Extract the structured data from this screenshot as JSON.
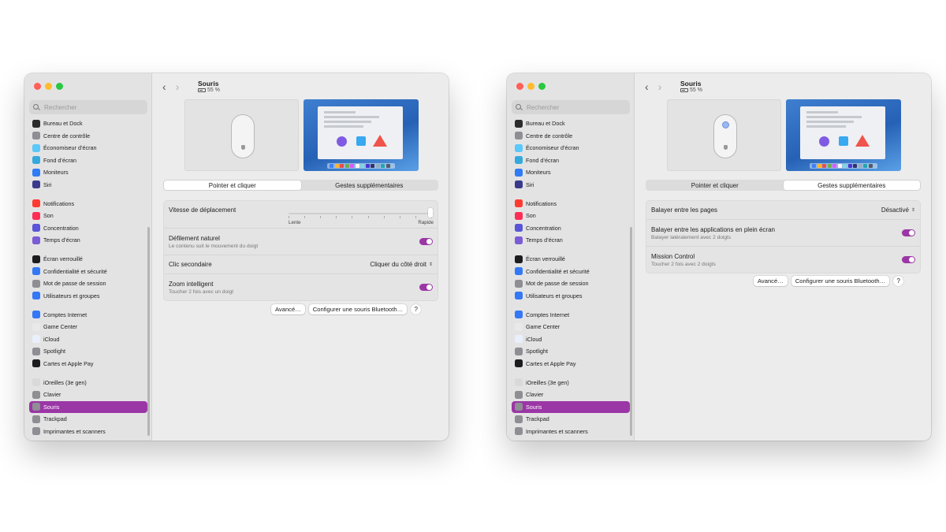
{
  "sidebar": {
    "search_placeholder": "Rechercher",
    "items": [
      {
        "label": "Bureau et Dock",
        "icon": "dock-icon",
        "color": "#2b2b2b"
      },
      {
        "label": "Centre de contrôle",
        "icon": "control-center-icon",
        "color": "#8e8e93"
      },
      {
        "label": "Économiseur d’écran",
        "icon": "screensaver-icon",
        "color": "#5ac8fa"
      },
      {
        "label": "Fond d’écran",
        "icon": "wallpaper-icon",
        "color": "#34aadc"
      },
      {
        "label": "Moniteurs",
        "icon": "displays-icon",
        "color": "#2f7cf6"
      },
      {
        "label": "Siri",
        "icon": "siri-icon",
        "color": "#3a3a8c"
      },
      {
        "label": "Notifications",
        "icon": "notifications-icon",
        "color": "#ff3b30"
      },
      {
        "label": "Son",
        "icon": "sound-icon",
        "color": "#ff2d55"
      },
      {
        "label": "Concentration",
        "icon": "focus-icon",
        "color": "#5856d6"
      },
      {
        "label": "Temps d’écran",
        "icon": "screen-time-icon",
        "color": "#7b5cd6"
      },
      {
        "label": "Écran verrouillé",
        "icon": "lock-screen-icon",
        "color": "#1c1c1e"
      },
      {
        "label": "Confidentialité et sécurité",
        "icon": "privacy-icon",
        "color": "#3478f6"
      },
      {
        "label": "Mot de passe de session",
        "icon": "password-icon",
        "color": "#8e8e93"
      },
      {
        "label": "Utilisateurs et groupes",
        "icon": "users-icon",
        "color": "#3478f6"
      },
      {
        "label": "Comptes Internet",
        "icon": "internet-accounts-icon",
        "color": "#3478f6"
      },
      {
        "label": "Game Center",
        "icon": "game-center-icon",
        "color": "#e9e9e9"
      },
      {
        "label": "iCloud",
        "icon": "icloud-icon",
        "color": "#e9f0fb"
      },
      {
        "label": "Spotlight",
        "icon": "spotlight-icon",
        "color": "#8e8e93"
      },
      {
        "label": "Cartes et Apple Pay",
        "icon": "wallet-icon",
        "color": "#1c1c1e"
      },
      {
        "label": "iOreilles (3e gen)",
        "icon": "airpods-icon",
        "color": "#d9d9d9"
      },
      {
        "label": "Clavier",
        "icon": "keyboard-icon",
        "color": "#8e8e93"
      },
      {
        "label": "Souris",
        "icon": "mouse-icon",
        "color": "#8e8e93"
      },
      {
        "label": "Trackpad",
        "icon": "trackpad-icon",
        "color": "#8e8e93"
      },
      {
        "label": "Imprimantes et scanners",
        "icon": "printer-icon",
        "color": "#8e8e93"
      }
    ],
    "active_color": "#9b36a6"
  },
  "header": {
    "title": "Souris",
    "battery": "55 %"
  },
  "tabs": [
    "Pointer et cliquer",
    "Gestes supplémentaires"
  ],
  "left": {
    "tracking_label": "Vitesse de déplacement",
    "tracking_min": "Lente",
    "tracking_max": "Rapide",
    "tracking_value": 1.0,
    "natural_scroll_label": "Défilement naturel",
    "natural_scroll_sub": "Le contenu suit le mouvement du doigt",
    "natural_scroll_on": true,
    "secondary_click_label": "Clic secondaire",
    "secondary_click_value": "Cliquer du côté droit",
    "smart_zoom_label": "Zoom intelligent",
    "smart_zoom_sub": "Toucher 2 fois avec un doigt",
    "smart_zoom_on": true
  },
  "right": {
    "swipe_pages_label": "Balayer entre les pages",
    "swipe_pages_value": "Désactivé",
    "swipe_apps_label": "Balayer entre les applications en plein écran",
    "swipe_apps_sub": "Balayer latéralement avec 2 doigts",
    "swipe_apps_on": true,
    "mission_label": "Mission Control",
    "mission_sub": "Toucher 2 fois avec 2 doigts",
    "mission_on": true
  },
  "buttons": {
    "advanced": "Avancé…",
    "bluetooth": "Configurer une souris Bluetooth…",
    "help": "?"
  },
  "icons": {
    "back": "chevron-left-icon",
    "forward": "chevron-right-icon",
    "popup": "chevron-up-down-icon"
  }
}
